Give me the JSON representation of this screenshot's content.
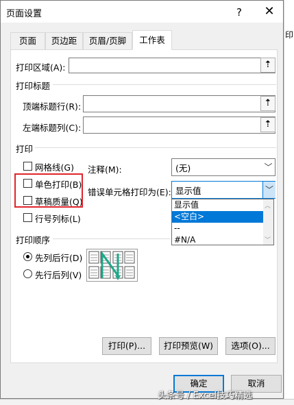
{
  "background": {
    "right_edge_text": "印"
  },
  "dialog": {
    "title": "页面设置",
    "help": "?",
    "close": "✕",
    "tabs": [
      {
        "label": "页面"
      },
      {
        "label": "页边距"
      },
      {
        "label": "页眉/页脚"
      },
      {
        "label": "工作表"
      }
    ],
    "print_area": {
      "label": "打印区域(A):",
      "value": ""
    },
    "print_titles": {
      "heading": "打印标题",
      "rows_label": "顶端标题行(R):",
      "rows_value": "",
      "cols_label": "左端标题列(C):",
      "cols_value": ""
    },
    "print": {
      "heading": "打印",
      "gridlines": {
        "label": "网格线(G)",
        "checked": false
      },
      "black_white": {
        "label": "单色打印(B)",
        "checked": false
      },
      "draft": {
        "label": "草稿质量(Q)",
        "checked": false
      },
      "headings": {
        "label": "行号列标(L)",
        "checked": false
      },
      "comments_label": "注释(M):",
      "comments_value": "(无)",
      "errors_label": "错误单元格打印为(E):",
      "errors_value": "显示值",
      "errors_options": [
        "显示值",
        "<空白>",
        "--",
        "#N/A"
      ],
      "errors_selected": "<空白>"
    },
    "page_order": {
      "heading": "打印顺序",
      "down_then_over": {
        "label": "先列后行(D)",
        "checked": true
      },
      "over_then_down": {
        "label": "先行后列(V)",
        "checked": false
      }
    },
    "buttons": {
      "print": "打印(P)...",
      "preview": "打印预览(W)",
      "options": "选项(O)...",
      "ok": "确定",
      "cancel": "取消"
    }
  },
  "watermark": "头条号 / Excel技巧精选",
  "colors": {
    "accent": "#0078d7",
    "highlight": "#e0242b",
    "diagram_arrow": "#1fa88a"
  }
}
